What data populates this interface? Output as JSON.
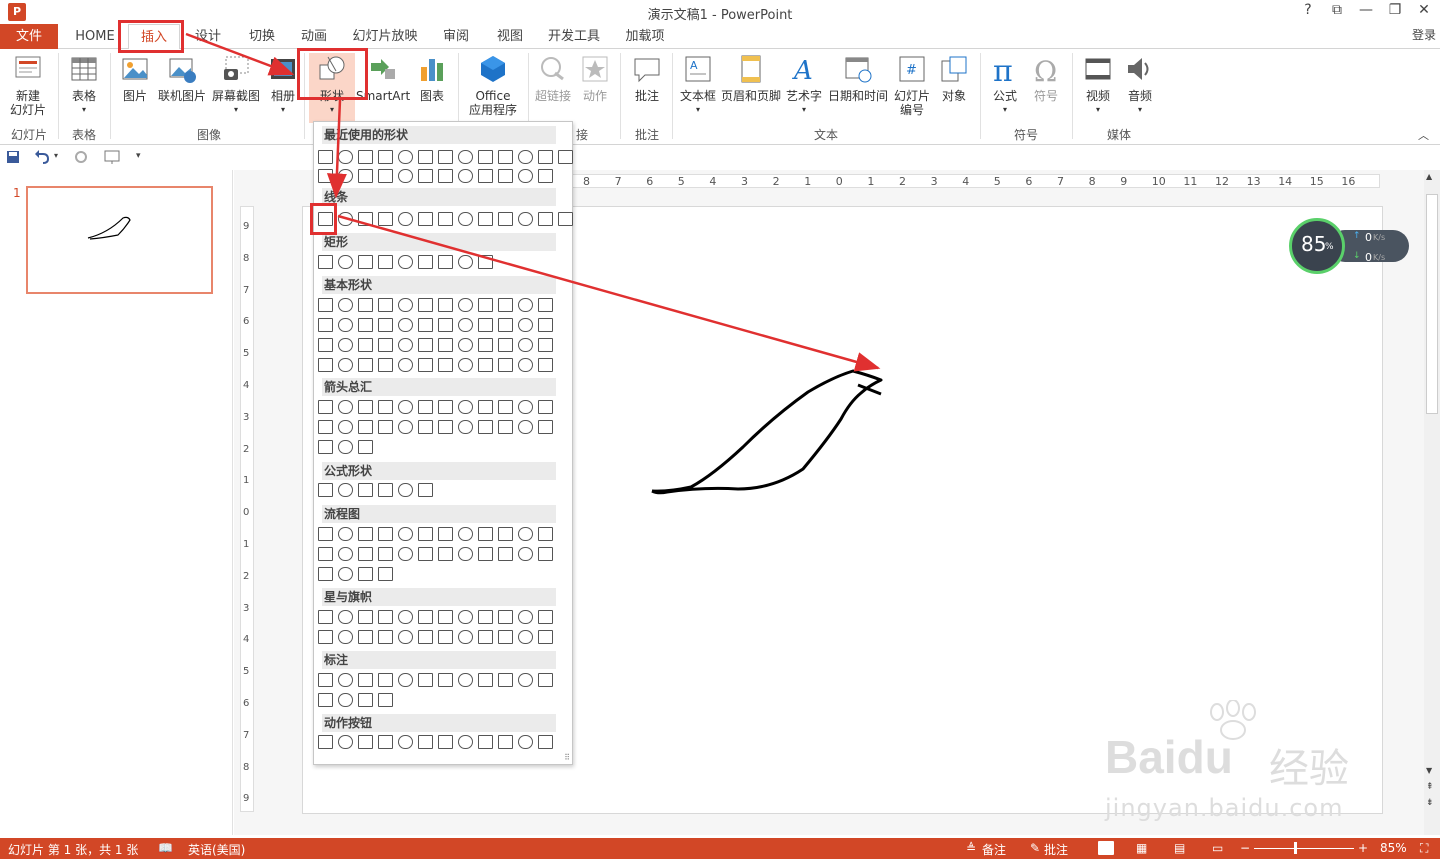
{
  "window": {
    "title": "演示文稿1 - PowerPoint",
    "logo": "P",
    "controls": [
      "?",
      "⧉",
      "—",
      "❐",
      "✕"
    ],
    "login": "登录"
  },
  "menu": {
    "file": "文件",
    "tabs": [
      "HOME",
      "插入",
      "设计",
      "切换",
      "动画",
      "幻灯片放映",
      "审阅",
      "视图",
      "开发工具",
      "加载项"
    ],
    "active_tab": "插入"
  },
  "ribbon": {
    "buttons": {
      "new_slide": "新建\n幻灯片",
      "table": "表格",
      "picture": "图片",
      "online_picture": "联机图片",
      "screenshot": "屏幕截图",
      "album": "相册",
      "shapes": "形状",
      "smartart": "SmartArt",
      "chart": "图表",
      "office_apps": "Office\n应用程序",
      "hyperlink": "超链接",
      "action": "动作",
      "comment": "批注",
      "textbox": "文本框",
      "header_footer": "页眉和页脚",
      "wordart": "艺术字",
      "datetime": "日期和时间",
      "slide_number": "幻灯片\n编号",
      "object": "对象",
      "equation": "公式",
      "symbol": "符号",
      "video": "视频",
      "audio": "音频"
    },
    "groups": {
      "slides": "幻灯片",
      "tables": "表格",
      "images": "图像",
      "links": "接",
      "comments": "批注",
      "text": "文本",
      "symbols": "符号",
      "media": "媒体"
    }
  },
  "thumbnail": {
    "number": "1"
  },
  "ruler": {
    "h_ticks": [
      "8",
      "7",
      "6",
      "5",
      "4",
      "3",
      "2",
      "1",
      "0",
      "1",
      "2",
      "3",
      "4",
      "5",
      "6",
      "7",
      "8",
      "9",
      "10",
      "11",
      "12",
      "13",
      "14",
      "15",
      "16"
    ],
    "v_ticks": [
      "9",
      "8",
      "7",
      "6",
      "5",
      "4",
      "3",
      "2",
      "1",
      "0",
      "1",
      "2",
      "3",
      "4",
      "5",
      "6",
      "7",
      "8",
      "9"
    ]
  },
  "shape_gallery": {
    "sections": [
      "最近使用的形状",
      "线条",
      "矩形",
      "基本形状",
      "箭头总汇",
      "公式形状",
      "流程图",
      "星与旗帜",
      "标注",
      "动作按钮"
    ]
  },
  "net_widget": {
    "percent": "85",
    "percent_sign": "%",
    "up": "0",
    "down": "0",
    "unit": "K/s"
  },
  "watermark": {
    "brand": "Bai",
    "brand2": "du",
    "cn": "经验",
    "url": "jingyan.baidu.com"
  },
  "status": {
    "slide_info": "幻灯片 第 1 张，共 1 张",
    "language": "英语(美国)",
    "notes": "备注",
    "comments": "批注",
    "zoom": "85%"
  },
  "colors": {
    "accent": "#d24726",
    "annotation": "#e03030"
  }
}
